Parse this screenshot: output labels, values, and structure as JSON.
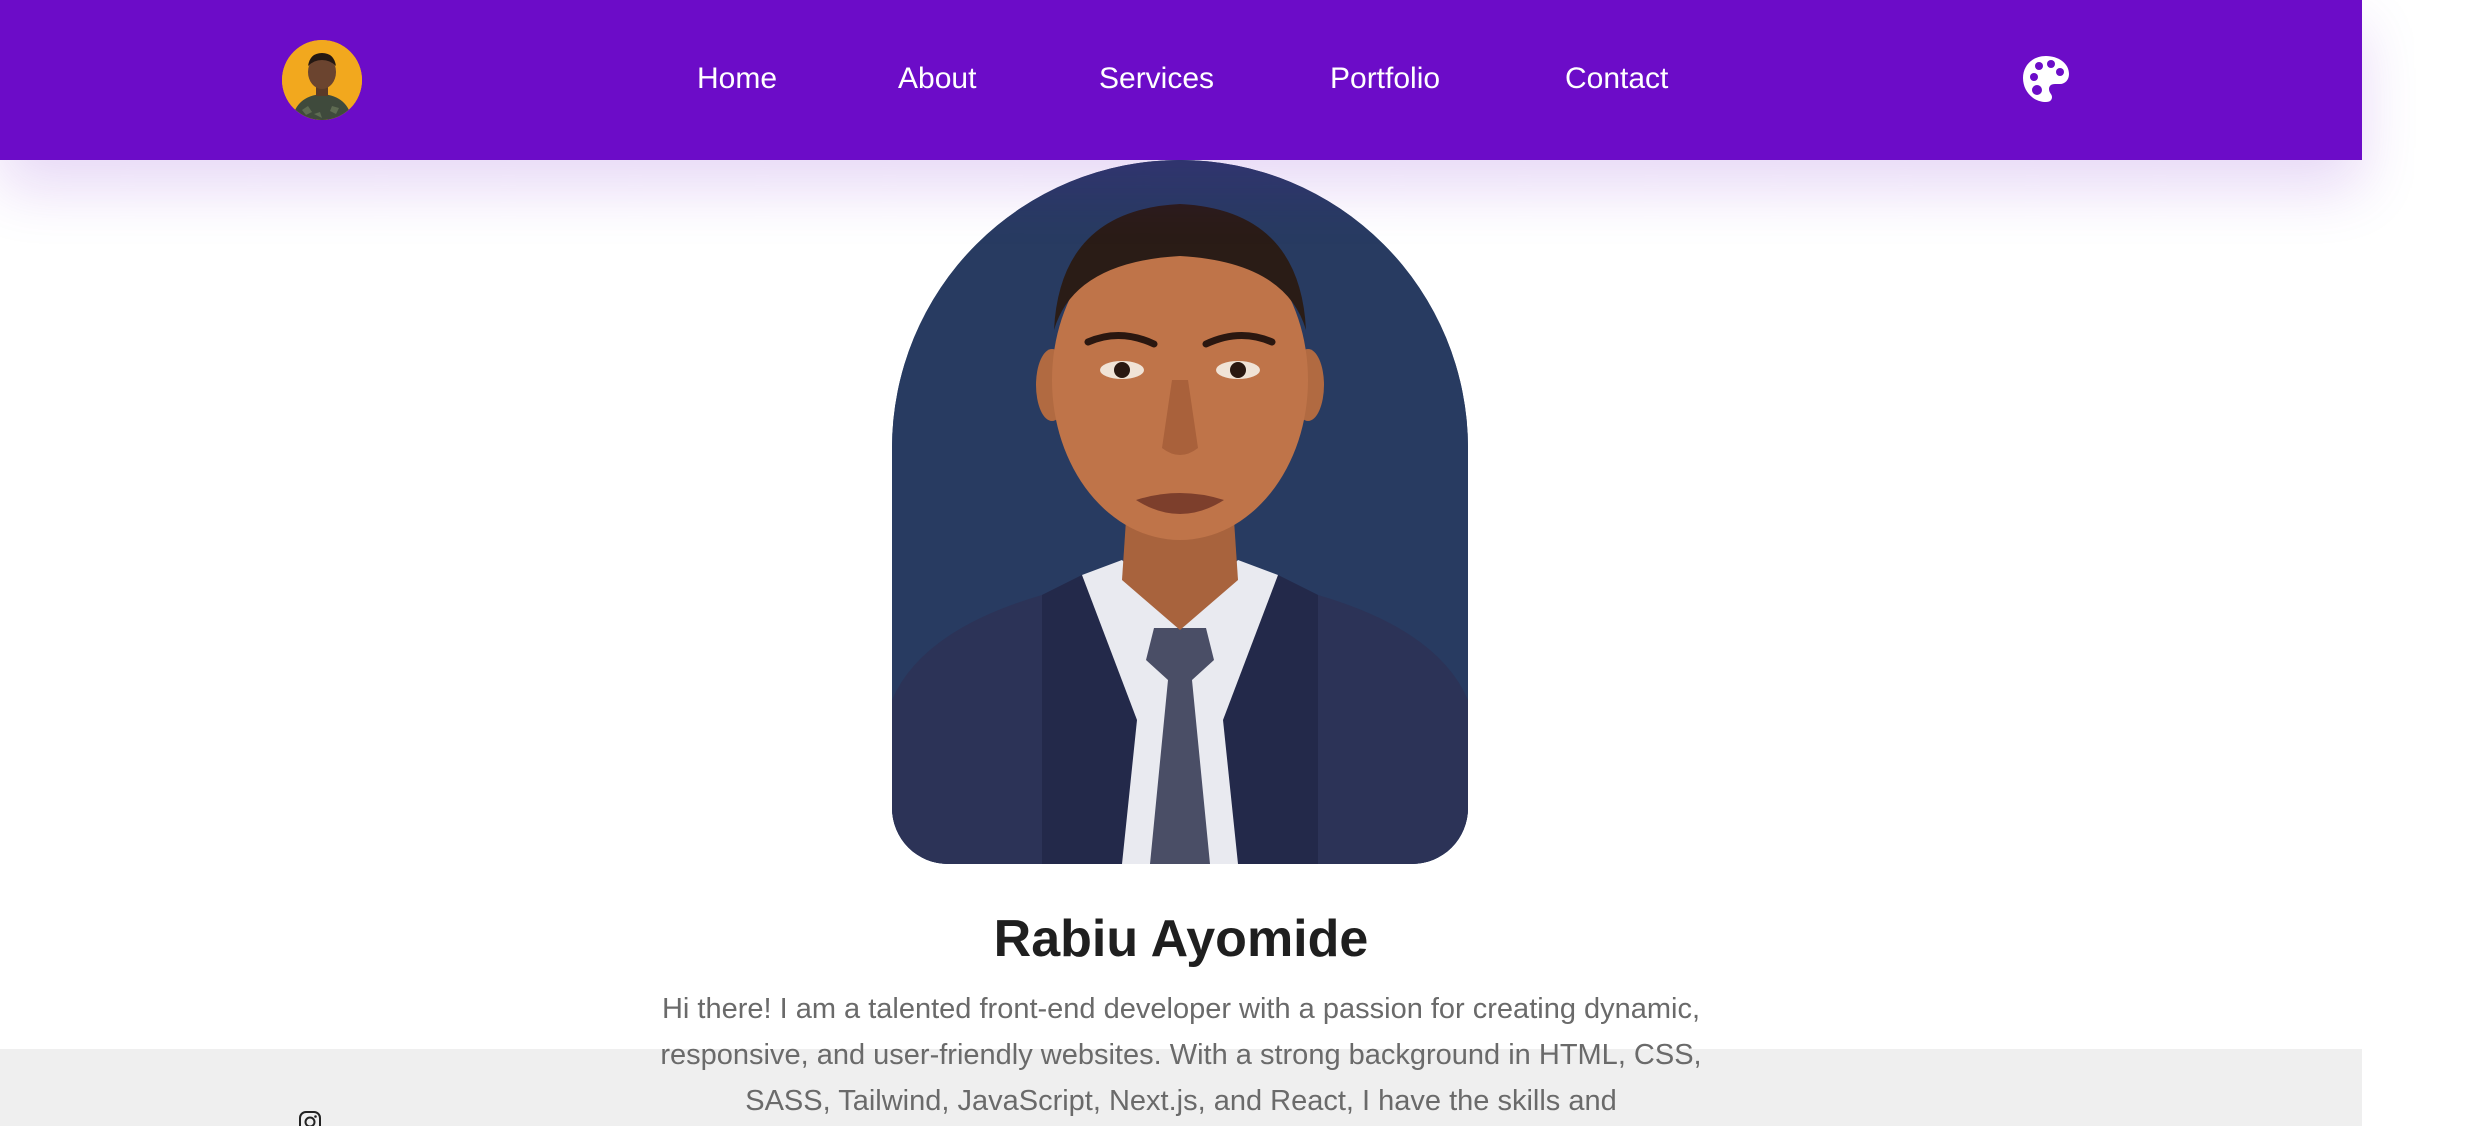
{
  "header": {
    "nav": [
      "Home",
      "About",
      "Services",
      "Portfolio",
      "Contact"
    ]
  },
  "hero": {
    "name": "Rabiu Ayomide",
    "bio": "Hi there! I am a talented front-end developer with a passion for creating dynamic, responsive, and user-friendly websites. With a strong background in HTML, CSS, SASS, Tailwind, JavaScript, Next.js, and React, I have the skills and"
  },
  "icons": {
    "logo": "avatar",
    "theme": "palette-icon",
    "social": "instagram-icon"
  },
  "colors": {
    "header_bg": "#6c0cc8",
    "portrait_bg": "#283b61",
    "logo_bg": "#f2a81e",
    "band_bg": "#efefef",
    "name_text": "#1f1f1f",
    "bio_text": "#6a6a6a"
  }
}
